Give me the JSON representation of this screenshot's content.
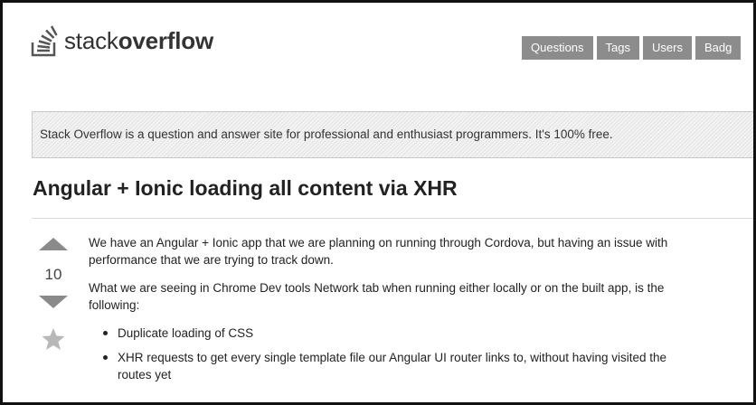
{
  "header": {
    "logo_text_regular": "stack",
    "logo_text_bold": "overflow",
    "nav": [
      {
        "label": "Questions"
      },
      {
        "label": "Tags"
      },
      {
        "label": "Users"
      },
      {
        "label": "Badg"
      }
    ]
  },
  "banner": {
    "text": "Stack Overflow is a question and answer site for professional and enthusiast programmers. It's 100% free."
  },
  "question": {
    "title": "Angular + Ionic loading all content via XHR",
    "votes": "10",
    "paragraphs": [
      "We have an Angular + Ionic app that we are planning on running through Cordova, but having an issue with performance that we are trying to track down.",
      "What we are seeing in Chrome Dev tools Network tab when running either locally or on the built app, is the following:"
    ],
    "bullets": [
      "Duplicate loading of CSS",
      "XHR requests to get every single template file our Angular UI router links to, without having visited the routes yet"
    ]
  },
  "icons": {
    "logo": "stack-overflow-logo-icon",
    "upvote": "upvote-arrow-icon",
    "downvote": "downvote-arrow-icon",
    "favorite": "star-icon"
  },
  "colors": {
    "nav_bg": "#8c8c8c",
    "vote_arrow": "#8a8a8a",
    "star": "#b8b8b8"
  }
}
